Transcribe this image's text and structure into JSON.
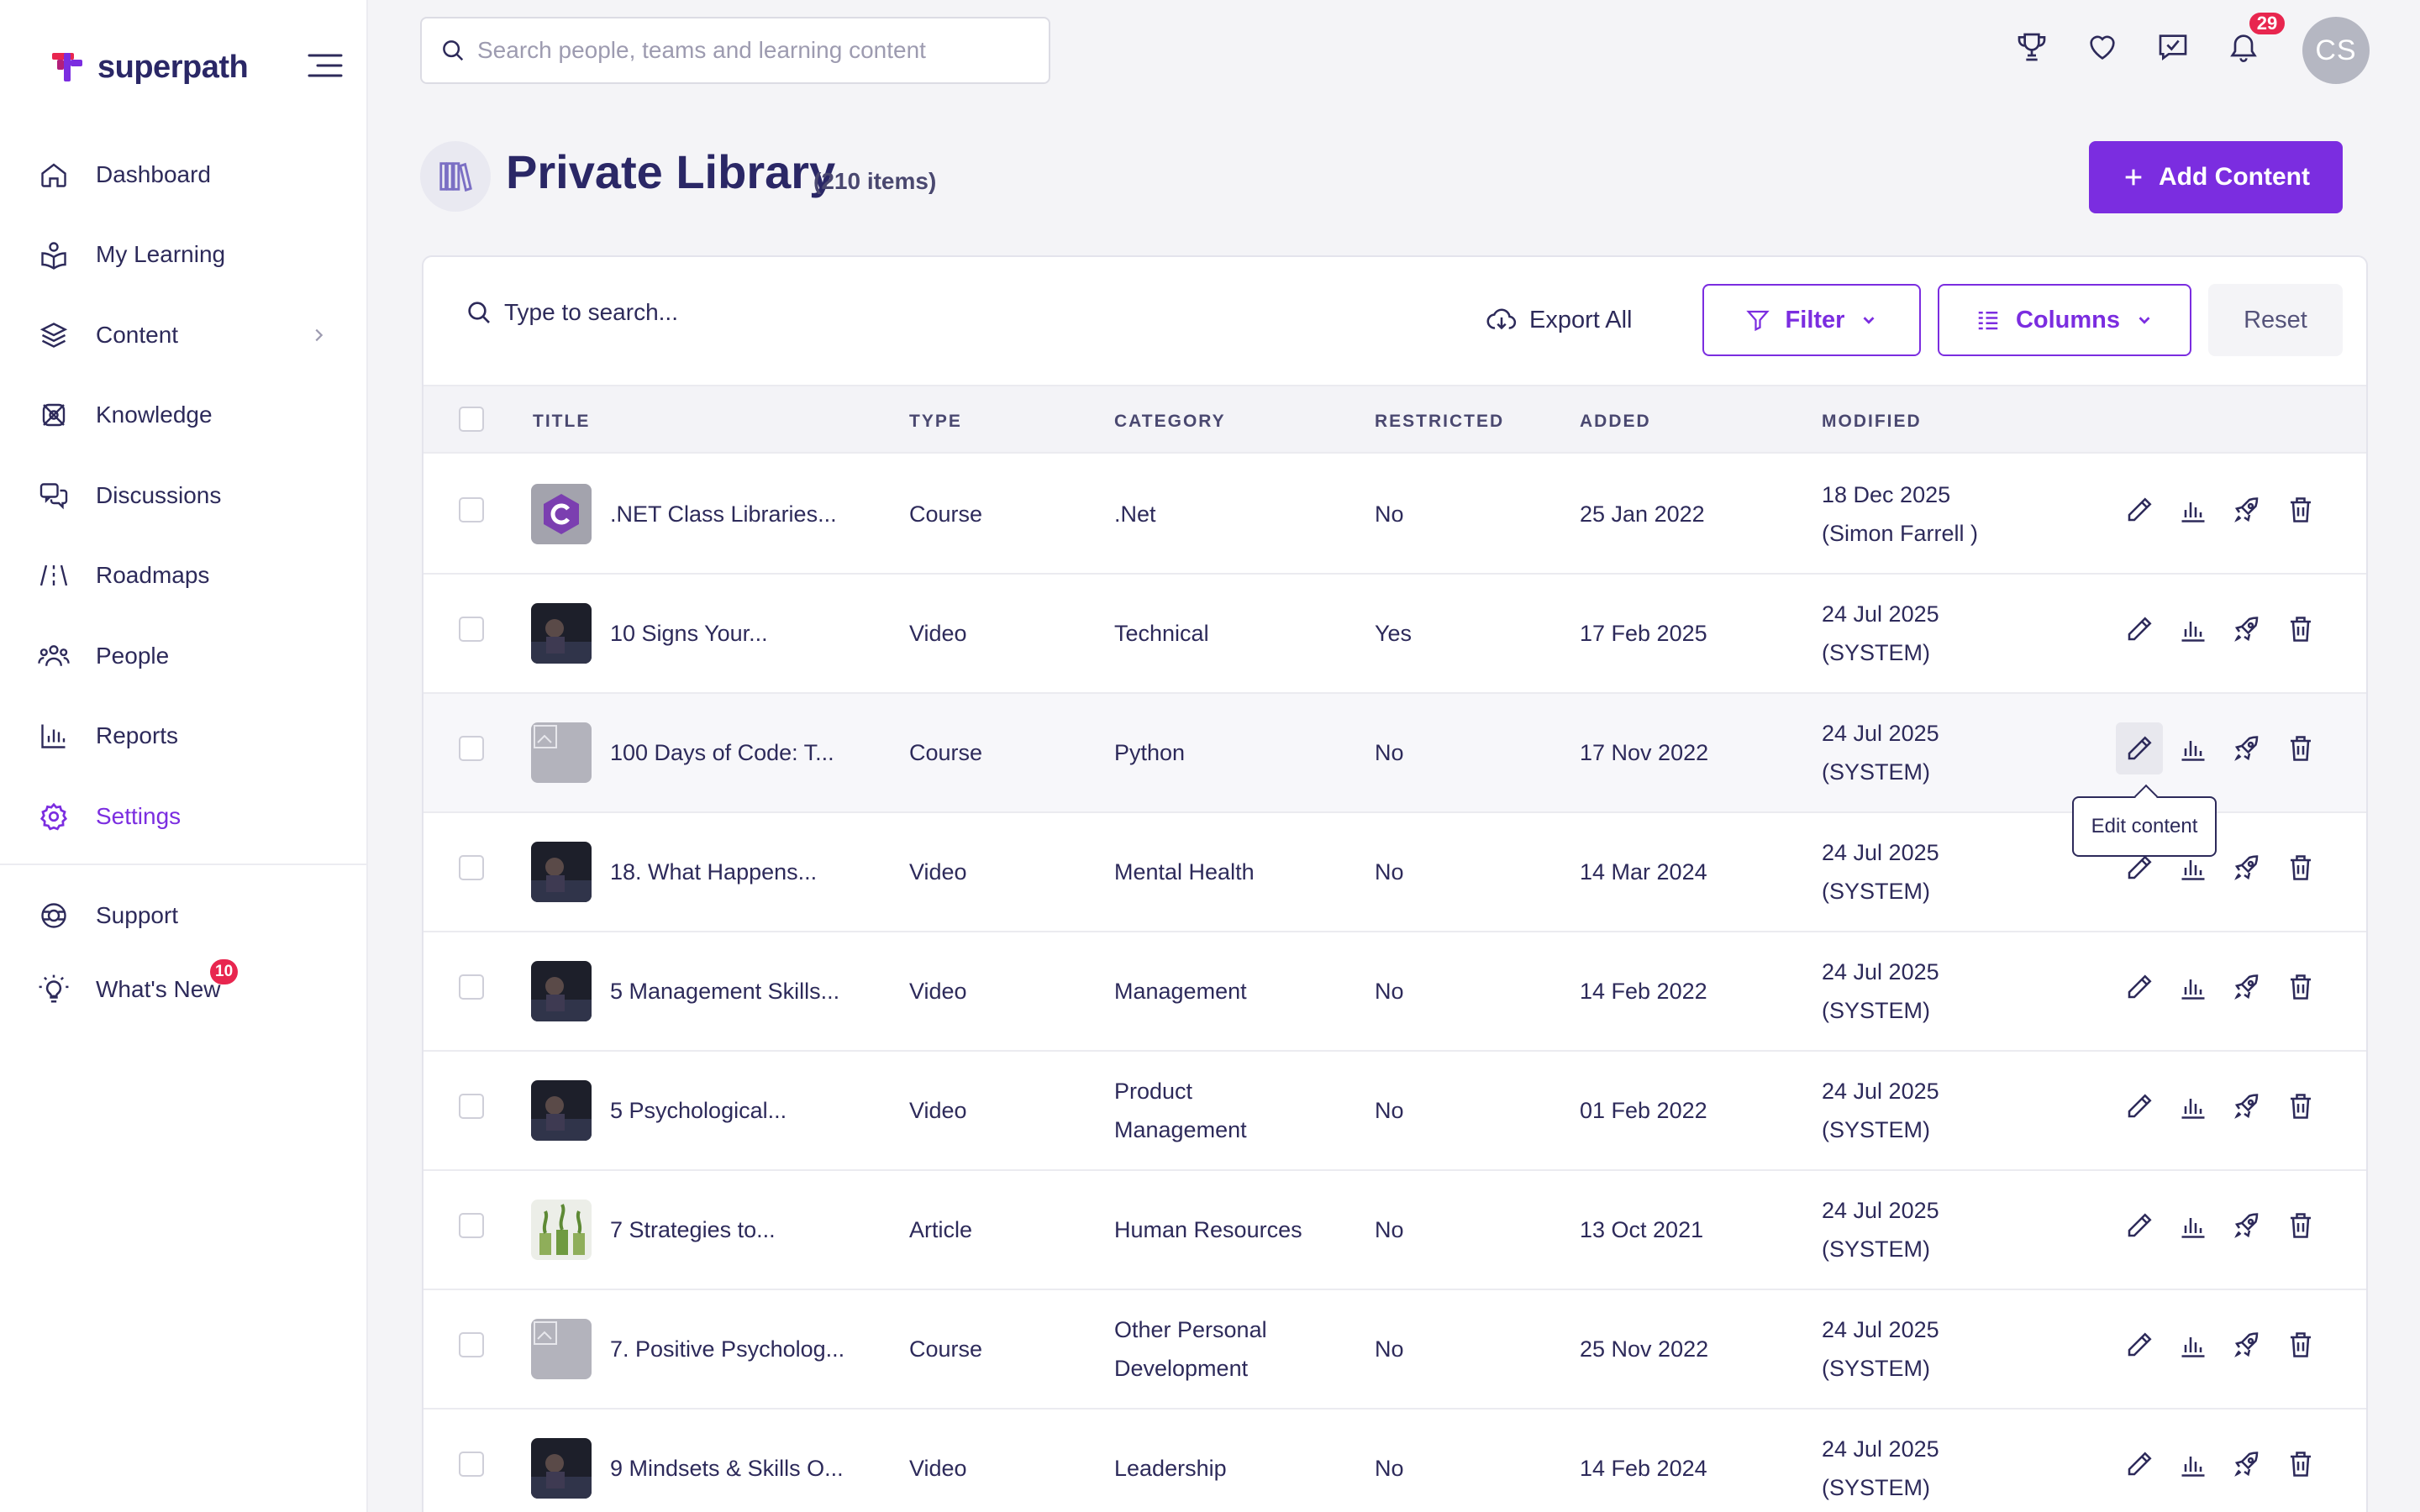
{
  "brand": {
    "name": "superpath",
    "accent": "#7b2de0",
    "logo_colors": [
      "#e8264f",
      "#7b2de0"
    ]
  },
  "sidebar": {
    "items": [
      {
        "label": "Dashboard",
        "icon": "home-icon"
      },
      {
        "label": "My Learning",
        "icon": "book-reader-icon"
      },
      {
        "label": "Content",
        "icon": "layers-icon",
        "has_submenu": true
      },
      {
        "label": "Knowledge",
        "icon": "knowledge-icon"
      },
      {
        "label": "Discussions",
        "icon": "chat-icon"
      },
      {
        "label": "Roadmaps",
        "icon": "road-icon"
      },
      {
        "label": "People",
        "icon": "people-icon"
      },
      {
        "label": "Reports",
        "icon": "bar-chart-icon"
      },
      {
        "label": "Settings",
        "icon": "gear-icon",
        "active": true
      }
    ],
    "secondary": [
      {
        "label": "Support",
        "icon": "lifebuoy-icon"
      },
      {
        "label": "What's New",
        "icon": "lightbulb-icon",
        "badge": "10"
      }
    ]
  },
  "header": {
    "search_placeholder": "Search people, teams and learning content",
    "notifications_count": "29",
    "avatar_initials": "CS"
  },
  "page": {
    "title": "Private Library",
    "count": "(210 items)",
    "add_button": "Add Content"
  },
  "toolbar": {
    "search_placeholder": "Type to search...",
    "export_label": "Export All",
    "filter_label": "Filter",
    "columns_label": "Columns",
    "reset_label": "Reset"
  },
  "table": {
    "columns": [
      "Title",
      "Type",
      "Category",
      "Restricted",
      "Added",
      "Modified"
    ],
    "rows": [
      {
        "title": ".NET Class Libraries...",
        "type": "Course",
        "category": [
          ".Net"
        ],
        "restricted": "No",
        "added": "25 Jan 2022",
        "modified": [
          "18 Dec 2025",
          "(Simon Farrell )"
        ],
        "thumb": "csharp-logo"
      },
      {
        "title": "10 Signs Your...",
        "type": "Video",
        "category": [
          "Technical"
        ],
        "restricted": "Yes",
        "added": "17 Feb 2025",
        "modified": [
          "24 Jul 2025",
          "(SYSTEM)"
        ],
        "thumb": "video-still"
      },
      {
        "title": "100 Days of Code: T...",
        "type": "Course",
        "category": [
          "Python"
        ],
        "restricted": "No",
        "added": "17 Nov 2022",
        "modified": [
          "24 Jul 2025",
          "(SYSTEM)"
        ],
        "thumb": "placeholder-image"
      },
      {
        "title": "18. What Happens...",
        "type": "Video",
        "category": [
          "Mental Health"
        ],
        "restricted": "No",
        "added": "14 Mar 2024",
        "modified": [
          "24 Jul 2025",
          "(SYSTEM)"
        ],
        "thumb": "video-still"
      },
      {
        "title": "5 Management Skills...",
        "type": "Video",
        "category": [
          "Management"
        ],
        "restricted": "No",
        "added": "14 Feb 2022",
        "modified": [
          "24 Jul 2025",
          "(SYSTEM)"
        ],
        "thumb": "video-still"
      },
      {
        "title": "5 Psychological...",
        "type": "Video",
        "category": [
          "Product",
          "Management"
        ],
        "restricted": "No",
        "added": "01 Feb 2022",
        "modified": [
          "24 Jul 2025",
          "(SYSTEM)"
        ],
        "thumb": "video-still"
      },
      {
        "title": "7 Strategies to...",
        "type": "Article",
        "category": [
          "Human Resources"
        ],
        "restricted": "No",
        "added": "13 Oct 2021",
        "modified": [
          "24 Jul 2025",
          "(SYSTEM)"
        ],
        "thumb": "plant-photo"
      },
      {
        "title": "7. Positive Psycholog...",
        "type": "Course",
        "category": [
          "Other Personal",
          "Development"
        ],
        "restricted": "No",
        "added": "25 Nov 2022",
        "modified": [
          "24 Jul 2025",
          "(SYSTEM)"
        ],
        "thumb": "placeholder-image"
      },
      {
        "title": "9 Mindsets & Skills O...",
        "type": "Video",
        "category": [
          "Leadership"
        ],
        "restricted": "No",
        "added": "14 Feb 2024",
        "modified": [
          "24 Jul 2025",
          "(SYSTEM)"
        ],
        "thumb": "video-still"
      }
    ],
    "tooltip": "Edit content"
  }
}
